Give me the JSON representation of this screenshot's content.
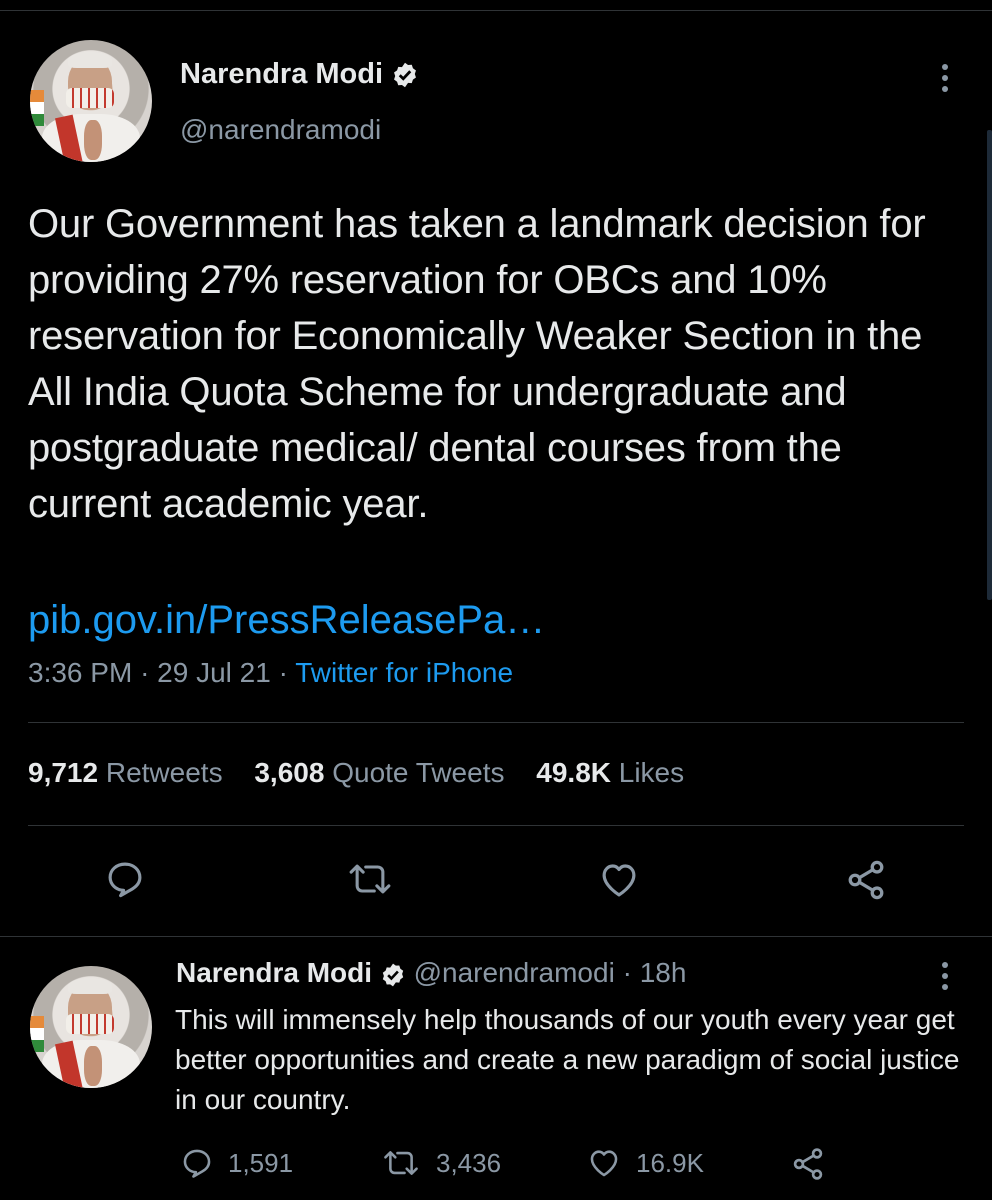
{
  "main_tweet": {
    "author_name": "Narendra Modi",
    "author_handle": "@narendramodi",
    "text": "Our Government has taken a landmark decision for providing 27% reservation for OBCs and 10% reservation for Economically Weaker Section in the All India Quota Scheme for undergraduate and postgraduate medical/ dental courses from the current academic year.",
    "link": "pib.gov.in/PressReleasePa…",
    "time": "3:36 PM",
    "date": "29 Jul 21",
    "separator": "·",
    "source": "Twitter for iPhone",
    "stats": {
      "retweets_count": "9,712",
      "retweets_label": "Retweets",
      "quotes_count": "3,608",
      "quotes_label": "Quote Tweets",
      "likes_count": "49.8K",
      "likes_label": "Likes"
    }
  },
  "reply_tweet": {
    "author_name": "Narendra Modi",
    "author_handle": "@narendramodi",
    "age": "18h",
    "separator": "·",
    "text": "This will immensely help thousands of our youth every year get better opportunities and create a new paradigm of social justice in our country.",
    "reply_count": "1,591",
    "retweet_count": "3,436",
    "like_count": "16.9K"
  },
  "icons": [
    "verified-badge-icon",
    "more-options-icon",
    "reply-icon",
    "retweet-icon",
    "like-icon",
    "share-icon"
  ],
  "colors": {
    "background": "#000000",
    "text": "#e7e9ea",
    "muted": "#8b98a5",
    "link": "#1d9bf0",
    "divider": "#2f3336"
  }
}
